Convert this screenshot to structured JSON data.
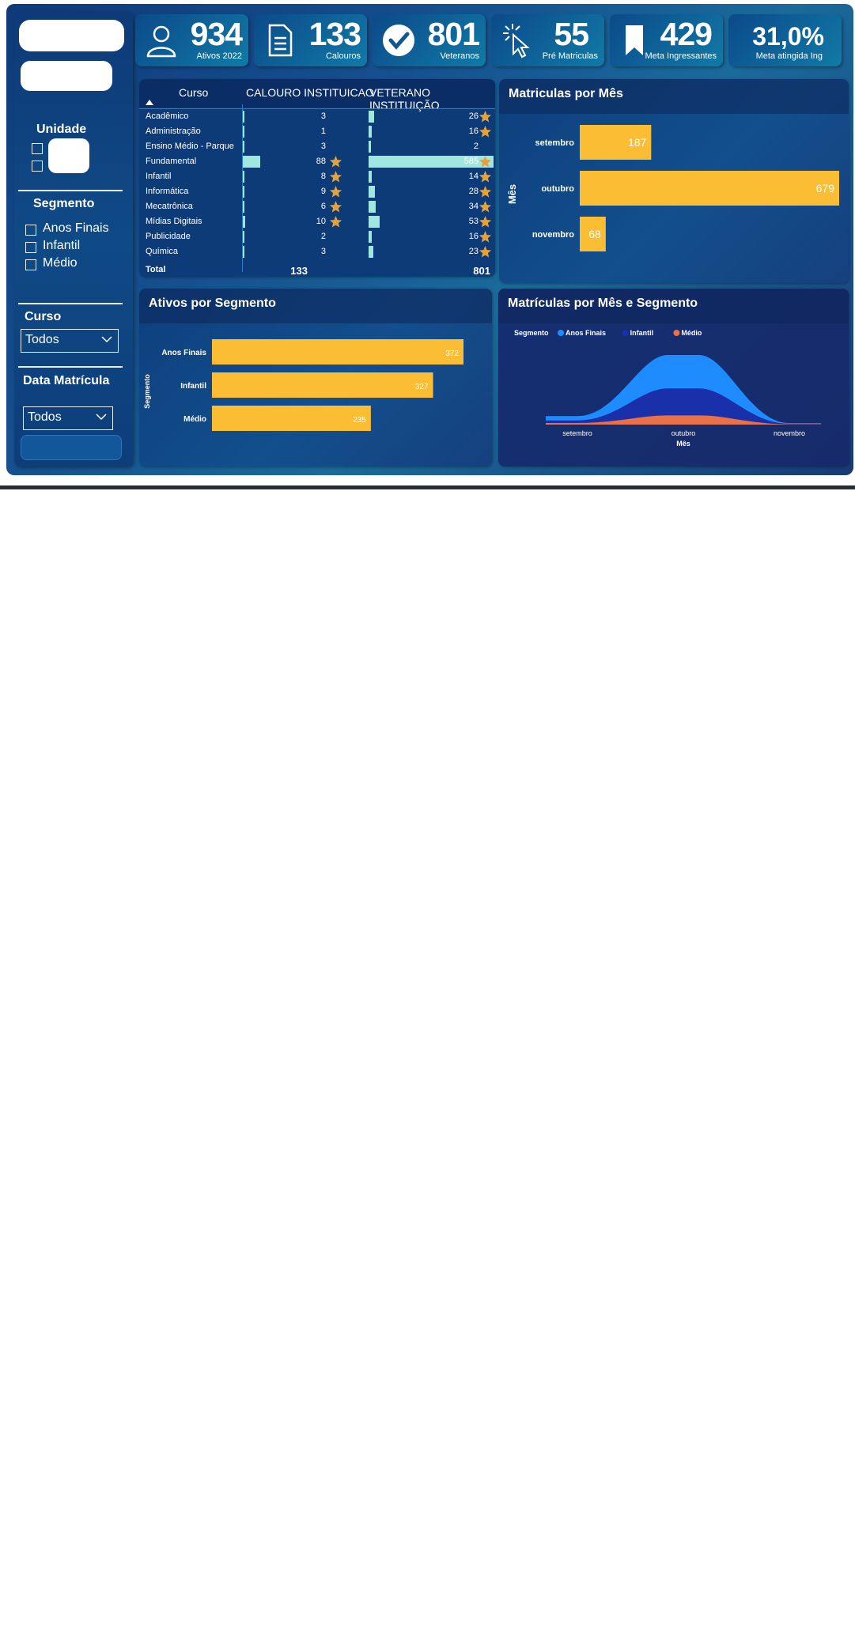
{
  "kpis": [
    {
      "value": "934",
      "label": "Ativos 2022",
      "icon": "user-icon"
    },
    {
      "value": "133",
      "label": "Calouros",
      "icon": "document-icon"
    },
    {
      "value": "801",
      "label": "Veteranos",
      "icon": "check-circle-icon"
    },
    {
      "value": "55",
      "label": "Pré Matriculas",
      "icon": "pointer-click-icon"
    },
    {
      "value": "429",
      "label": "Meta Ingressantes",
      "icon": "bookmark-icon"
    },
    {
      "value": "31,0%",
      "label": "Meta atingida Ing"
    }
  ],
  "sidebar": {
    "unidade_title": "Unidade",
    "segmento_title": "Segmento",
    "segmento_options": [
      "Anos Finais",
      "Infantil",
      "Médio"
    ],
    "curso_title": "Curso",
    "curso_value": "Todos",
    "data_title": "Data Matrícula",
    "data_value": "Todos"
  },
  "table": {
    "headers": [
      "Curso",
      "CALOURO INSTITUICAO",
      "VETERANO INSTITUIÇÃO"
    ],
    "rows": [
      {
        "curso": "Acadêmico",
        "calouro": 3,
        "veterano": 26,
        "star_c": false,
        "star_v": true
      },
      {
        "curso": "Administração",
        "calouro": 1,
        "veterano": 16,
        "star_c": false,
        "star_v": true
      },
      {
        "curso": "Ensino Médio - Parque",
        "calouro": 3,
        "veterano": 2,
        "star_c": false,
        "star_v": false
      },
      {
        "curso": "Fundamental",
        "calouro": 88,
        "veterano": 585,
        "star_c": true,
        "star_v": true
      },
      {
        "curso": "Infantil",
        "calouro": 8,
        "veterano": 14,
        "star_c": true,
        "star_v": true
      },
      {
        "curso": "Informática",
        "calouro": 9,
        "veterano": 28,
        "star_c": true,
        "star_v": true
      },
      {
        "curso": "Mecatrônica",
        "calouro": 6,
        "veterano": 34,
        "star_c": true,
        "star_v": true
      },
      {
        "curso": "Mídias Digitais",
        "calouro": 10,
        "veterano": 53,
        "star_c": true,
        "star_v": true
      },
      {
        "curso": "Publicidade",
        "calouro": 2,
        "veterano": 16,
        "star_c": false,
        "star_v": true
      },
      {
        "curso": "Química",
        "calouro": 3,
        "veterano": 23,
        "star_c": false,
        "star_v": true
      }
    ],
    "total": {
      "label": "Total",
      "calouro": "133",
      "veterano": "801"
    },
    "colors": {
      "bar": "#9fe7df",
      "star": "#e3a33c"
    }
  },
  "chart_data": [
    {
      "type": "bar",
      "orientation": "horizontal",
      "title": "Matriculas por Mês",
      "ylabel": "Mês",
      "categories": [
        "setembro",
        "outubro",
        "novembro"
      ],
      "values": [
        187,
        679,
        68
      ],
      "color": "#fbbd33"
    },
    {
      "type": "bar",
      "orientation": "horizontal",
      "title": "Ativos por Segmento",
      "ylabel": "Segmento",
      "categories": [
        "Anos Finais",
        "Infantil",
        "Médio"
      ],
      "values": [
        372,
        327,
        235
      ],
      "color": "#fbbd33"
    },
    {
      "type": "area",
      "title": "Matrículas por Mês e Segmento",
      "xlabel": "Mês",
      "legend_title": "Segmento",
      "categories": [
        "setembro",
        "outubro",
        "novembro"
      ],
      "series": [
        {
          "name": "Anos Finais",
          "values": [
            38,
            290,
            6
          ],
          "color": "#1e8cff"
        },
        {
          "name": "Infantil",
          "values": [
            22,
            234,
            4
          ],
          "color": "#1a2faa"
        },
        {
          "name": "Médio",
          "values": [
            14,
            80,
            3
          ],
          "color": "#e8714a"
        }
      ]
    }
  ]
}
